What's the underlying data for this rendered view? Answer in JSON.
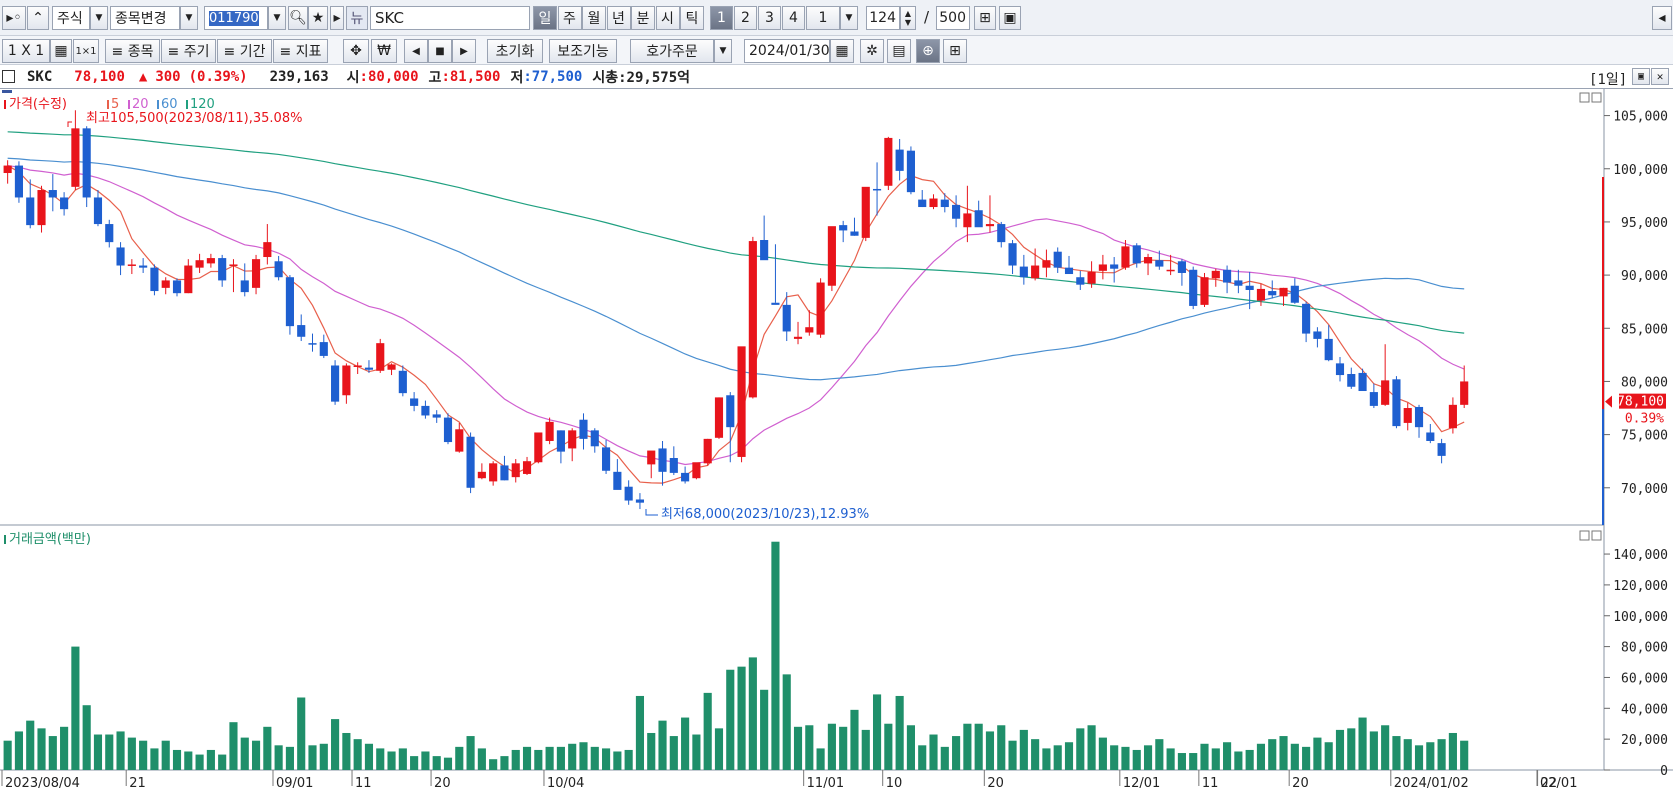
{
  "toolbar1": {
    "market": "주식",
    "change_label": "종목변경",
    "code_value": "011790",
    "news_label": "뉴",
    "name_value": "SKC",
    "period_tabs": [
      "일",
      "주",
      "월",
      "년",
      "분",
      "시",
      "틱"
    ],
    "active_period": "일",
    "count_tabs": [
      "1",
      "2",
      "3",
      "4",
      "1"
    ],
    "active_count": "1",
    "display_count": "124",
    "max_count": "500",
    "slash": "/"
  },
  "toolbar2": {
    "layout_label": "1 X 1",
    "menu_items": [
      "≡ 종목",
      "≡ 주기",
      "≡ 기간",
      "≡ 지표"
    ],
    "reset_label": "초기화",
    "aux_label": "보조기능",
    "order_label": "호가주문",
    "date_value": "2024/01/30"
  },
  "info": {
    "name": "SKC",
    "price": "78,100",
    "change_arrow": "▲",
    "change": "300",
    "change_pct": "(0.39%)",
    "volume": "239,163",
    "open_label": "시",
    "open": ":80,000",
    "high_label": "고",
    "high": ":81,500",
    "low_label": "저",
    "low": ":77,500",
    "cap_label": "시총",
    "cap": ":29,575억",
    "period_badge": "[1일]"
  },
  "price_panel": {
    "title": "가격(수정)",
    "ma_legend": [
      {
        "label": "5",
        "color": "#e8604c"
      },
      {
        "label": "20",
        "color": "#d060d0"
      },
      {
        "label": "60",
        "color": "#4a8fd0"
      },
      {
        "label": "120",
        "color": "#20a080"
      }
    ],
    "high_note": "최고105,500(2023/08/11),35.08%",
    "low_note": "최저68,000(2023/10/23),12.93%",
    "y_ticks": [
      "105,000",
      "100,000",
      "95,000",
      "90,000",
      "85,000",
      "80,000",
      "75,000",
      "70,000"
    ],
    "current_price_tag": "78,100",
    "current_pct_tag": "0.39%"
  },
  "volume_panel": {
    "title": "거래금액(백만)",
    "y_ticks": [
      "140,000",
      "120,000",
      "100,000",
      "80,000",
      "60,000",
      "40,000",
      "20,000",
      "0"
    ]
  },
  "x_ticks": [
    "2023/08/04",
    "21",
    "09/01",
    "11",
    "20",
    "10/04",
    "11/01",
    "10",
    "20",
    "12/01",
    "11",
    "20",
    "2024/01/02",
    "22",
    "02/01"
  ],
  "colors": {
    "up": "#e8141b",
    "down": "#1e5fd0",
    "volume": "#1f8f6a",
    "ma5": "#e8604c",
    "ma20": "#d060d0",
    "ma60": "#4a8fd0",
    "ma120": "#20a080"
  },
  "chart_data": [
    {
      "type": "candlestick",
      "title": "가격(수정)",
      "ylim": [
        66500,
        107500
      ],
      "y_ticks": [
        70000,
        75000,
        80000,
        85000,
        90000,
        95000,
        100000,
        105000
      ],
      "ohlc": [
        [
          99600,
          100800,
          98600,
          100300
        ],
        [
          100300,
          100700,
          96800,
          97300
        ],
        [
          97300,
          99000,
          94400,
          94700
        ],
        [
          94700,
          98400,
          94000,
          98000
        ],
        [
          98000,
          99500,
          96000,
          97300
        ],
        [
          97300,
          97800,
          95600,
          96200
        ],
        [
          98300,
          105500,
          98000,
          103800
        ],
        [
          103800,
          104000,
          96400,
          97300
        ],
        [
          97300,
          98000,
          94600,
          94800
        ],
        [
          94800,
          95200,
          92600,
          93100
        ],
        [
          92600,
          93100,
          90000,
          90900
        ],
        [
          90900,
          91500,
          90100,
          91000
        ],
        [
          90900,
          91600,
          90200,
          90700
        ],
        [
          90700,
          91000,
          88100,
          88500
        ],
        [
          88800,
          89800,
          88200,
          89500
        ],
        [
          89500,
          89700,
          88000,
          88300
        ],
        [
          88300,
          91500,
          88300,
          90900
        ],
        [
          90700,
          92000,
          90200,
          91400
        ],
        [
          91100,
          92000,
          90700,
          91600
        ],
        [
          91600,
          91900,
          88900,
          89500
        ],
        [
          91000,
          91500,
          88400,
          91000
        ],
        [
          89500,
          91100,
          88000,
          88400
        ],
        [
          88800,
          91900,
          88200,
          91500
        ],
        [
          91700,
          94800,
          91000,
          93100
        ],
        [
          91300,
          91800,
          89500,
          89800
        ],
        [
          89800,
          90000,
          84400,
          85200
        ],
        [
          85300,
          86300,
          83800,
          84200
        ],
        [
          83600,
          84500,
          82800,
          83500
        ],
        [
          83700,
          84400,
          82200,
          82400
        ],
        [
          81500,
          82000,
          77800,
          78100
        ],
        [
          78700,
          81700,
          77900,
          81500
        ],
        [
          81400,
          81800,
          80700,
          81500
        ],
        [
          81300,
          82000,
          80800,
          81100
        ],
        [
          81000,
          84000,
          80800,
          83600
        ],
        [
          81100,
          81700,
          80600,
          81600
        ],
        [
          81000,
          81500,
          78600,
          78900
        ],
        [
          78400,
          79000,
          77200,
          77700
        ],
        [
          77700,
          78200,
          76500,
          76800
        ],
        [
          76900,
          77300,
          76100,
          76600
        ],
        [
          76600,
          77000,
          74100,
          74300
        ],
        [
          73400,
          76100,
          73300,
          75500
        ],
        [
          74800,
          75200,
          69500,
          70000
        ],
        [
          70900,
          72300,
          70800,
          71500
        ],
        [
          70600,
          72500,
          70200,
          72300
        ],
        [
          72100,
          73000,
          70700,
          70700
        ],
        [
          71000,
          72700,
          70500,
          72300
        ],
        [
          71300,
          72900,
          71200,
          72500
        ],
        [
          72400,
          75000,
          72300,
          75200
        ],
        [
          74400,
          76600,
          74100,
          76200
        ],
        [
          75400,
          75400,
          72300,
          73400
        ],
        [
          73700,
          75600,
          72500,
          75400
        ],
        [
          76400,
          77000,
          73600,
          74600
        ],
        [
          75400,
          75600,
          73300,
          73900
        ],
        [
          73800,
          74500,
          71300,
          71600
        ],
        [
          71500,
          72700,
          70400,
          69800
        ],
        [
          70100,
          70700,
          68400,
          68800
        ],
        [
          68900,
          69500,
          68000,
          68600
        ],
        [
          72200,
          72600,
          70900,
          73500
        ],
        [
          73700,
          74400,
          70200,
          71500
        ],
        [
          72800,
          73900,
          71200,
          71400
        ],
        [
          71400,
          72000,
          70400,
          70600
        ],
        [
          70900,
          72200,
          70800,
          72400
        ],
        [
          72300,
          74600,
          72100,
          74600
        ],
        [
          74700,
          78500,
          74600,
          78500
        ],
        [
          78700,
          79000,
          72400,
          75700
        ],
        [
          72900,
          74500,
          72400,
          83300
        ],
        [
          78500,
          93600,
          78400,
          93200
        ],
        [
          93300,
          95600,
          91600,
          91400
        ],
        [
          87400,
          92900,
          87400,
          87200
        ],
        [
          87200,
          88400,
          83800,
          84700
        ],
        [
          84000,
          85600,
          83500,
          84200
        ],
        [
          84600,
          86700,
          84300,
          85100
        ],
        [
          84400,
          89700,
          84100,
          89300
        ],
        [
          89000,
          91200,
          88500,
          94600
        ],
        [
          94700,
          95100,
          93100,
          94200
        ],
        [
          94100,
          95400,
          93700,
          93700
        ],
        [
          93500,
          95900,
          93200,
          98300
        ],
        [
          98100,
          100600,
          95600,
          98000
        ],
        [
          98400,
          103000,
          98000,
          102900
        ],
        [
          101800,
          102800,
          98900,
          99800
        ],
        [
          101700,
          102100,
          97600,
          97800
        ],
        [
          97100,
          98000,
          96400,
          96400
        ],
        [
          96400,
          97600,
          96200,
          97200
        ],
        [
          97100,
          97700,
          95900,
          96400
        ],
        [
          96600,
          97500,
          94500,
          95300
        ],
        [
          94500,
          98400,
          93100,
          95800
        ],
        [
          96100,
          97000,
          94700,
          94500
        ],
        [
          94600,
          97500,
          94000,
          94800
        ],
        [
          94800,
          95000,
          92600,
          93100
        ],
        [
          93000,
          93300,
          90100,
          90900
        ],
        [
          90800,
          91900,
          89100,
          89800
        ],
        [
          89700,
          92500,
          89500,
          90900
        ],
        [
          90700,
          92400,
          89800,
          91400
        ],
        [
          92200,
          92600,
          90200,
          90700
        ],
        [
          90700,
          91800,
          90300,
          90100
        ],
        [
          89800,
          90400,
          88600,
          89100
        ],
        [
          89200,
          91300,
          88800,
          90300
        ],
        [
          90400,
          91900,
          89600,
          91000
        ],
        [
          91000,
          91700,
          89300,
          90600
        ],
        [
          90700,
          93300,
          90500,
          92700
        ],
        [
          92800,
          93000,
          90700,
          91100
        ],
        [
          91100,
          92000,
          90000,
          91700
        ],
        [
          91400,
          92300,
          90500,
          90800
        ],
        [
          90500,
          91900,
          90000,
          90500
        ],
        [
          91300,
          91500,
          89000,
          90200
        ],
        [
          90500,
          90800,
          86800,
          87100
        ],
        [
          87200,
          90200,
          87000,
          89800
        ],
        [
          89700,
          90600,
          88900,
          90400
        ],
        [
          90500,
          90900,
          88300,
          89300
        ],
        [
          89500,
          90500,
          88300,
          89000
        ],
        [
          89000,
          90300,
          86800,
          88600
        ],
        [
          87600,
          89200,
          87100,
          88700
        ],
        [
          88500,
          89500,
          87800,
          88100
        ],
        [
          88000,
          88800,
          87100,
          88800
        ],
        [
          89000,
          89700,
          87300,
          87400
        ],
        [
          87300,
          87500,
          83700,
          84500
        ],
        [
          84700,
          85100,
          83200,
          84000
        ],
        [
          84000,
          85300,
          81900,
          82000
        ],
        [
          81700,
          82300,
          80000,
          80600
        ],
        [
          80700,
          81300,
          79300,
          79500
        ],
        [
          80800,
          81200,
          79100,
          79100
        ],
        [
          79000,
          79800,
          77500,
          77700
        ],
        [
          77800,
          83500,
          77700,
          80100
        ],
        [
          80200,
          80500,
          75600,
          75800
        ],
        [
          76100,
          78000,
          75400,
          77500
        ],
        [
          77600,
          77800,
          74700,
          75700
        ],
        [
          75200,
          76000,
          74200,
          74400
        ],
        [
          74200,
          74600,
          72300,
          73000
        ],
        [
          75600,
          78500,
          75100,
          77800
        ],
        [
          77800,
          81500,
          77500,
          80000
        ]
      ]
    },
    {
      "type": "bar",
      "title": "거래금액(백만)",
      "ylim": [
        0,
        153000
      ],
      "y_ticks": [
        0,
        20000,
        40000,
        60000,
        80000,
        100000,
        120000,
        140000
      ],
      "values": [
        19000,
        25000,
        32000,
        27000,
        22000,
        28000,
        80000,
        42000,
        23000,
        23000,
        25000,
        21000,
        19000,
        14000,
        19000,
        13000,
        12000,
        10000,
        13000,
        10000,
        31000,
        21000,
        19000,
        28000,
        16000,
        15000,
        47000,
        16000,
        17000,
        33000,
        24000,
        20000,
        17000,
        14000,
        12000,
        14000,
        9000,
        12000,
        9000,
        8000,
        15000,
        22000,
        14000,
        7000,
        9000,
        13000,
        15000,
        13000,
        15000,
        15000,
        17000,
        18000,
        15000,
        14000,
        12000,
        13000,
        48000,
        24000,
        32000,
        22000,
        34000,
        23000,
        50000,
        27000,
        65000,
        67000,
        73000,
        52000,
        148000,
        62000,
        28000,
        29000,
        14000,
        30000,
        28000,
        39000,
        26000,
        49000,
        30000,
        48000,
        29000,
        16000,
        23000,
        15000,
        22000,
        30000,
        30000,
        25000,
        29000,
        19000,
        26000,
        20000,
        14000,
        16000,
        18000,
        27000,
        29000,
        21000,
        16000,
        15000,
        13000,
        16000,
        20000,
        14000,
        11000,
        11000,
        17000,
        14000,
        18000,
        12000,
        13000,
        17000,
        20000,
        22000,
        17000,
        15000,
        21000,
        18000,
        26000,
        27000,
        34000,
        25000,
        29000,
        22000,
        20000,
        16000,
        18000,
        20000,
        24000,
        19000
      ]
    }
  ]
}
